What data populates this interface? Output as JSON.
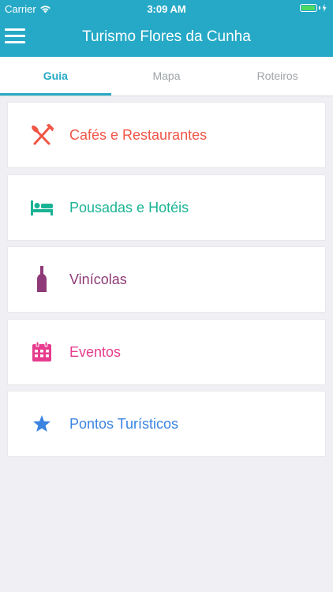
{
  "status_bar": {
    "carrier": "Carrier",
    "time": "3:09 AM"
  },
  "header": {
    "title": "Turismo Flores da Cunha",
    "menu_icon": "hamburger-menu-icon",
    "accent_color": "#26a9c6"
  },
  "tabs": [
    {
      "label": "Guia",
      "active": true
    },
    {
      "label": "Mapa",
      "active": false
    },
    {
      "label": "Roteiros",
      "active": false
    }
  ],
  "guide": {
    "items": [
      {
        "label": "Cafés e Restaurantes",
        "icon": "fork-knife-icon",
        "color": "#f05545"
      },
      {
        "label": "Pousadas e Hotéis",
        "icon": "bed-icon",
        "color": "#1ab394"
      },
      {
        "label": "Vinícolas",
        "icon": "wine-bottle-icon",
        "color": "#8e3a78"
      },
      {
        "label": "Eventos",
        "icon": "calendar-icon",
        "color": "#e73c8e"
      },
      {
        "label": "Pontos Turísticos",
        "icon": "star-icon",
        "color": "#3b83e0"
      }
    ]
  }
}
